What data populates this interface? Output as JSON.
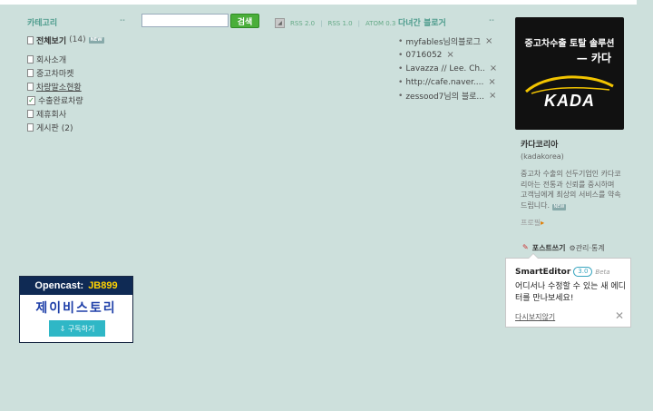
{
  "category": {
    "title": "카테고리",
    "all_label": "전체보기",
    "all_count": "(14)",
    "new_badge": "NEW",
    "items": [
      {
        "label": "회사소개",
        "check": false,
        "underline": false
      },
      {
        "label": "중고차마켓",
        "check": false,
        "underline": false
      },
      {
        "label": "차량말소현황",
        "check": false,
        "underline": true
      },
      {
        "label": "수출완료차량",
        "check": true,
        "underline": false
      },
      {
        "label": "제휴회사",
        "check": false,
        "underline": false
      },
      {
        "label": "게시판 (2)",
        "check": false,
        "underline": false
      }
    ]
  },
  "search": {
    "placeholder": "",
    "button_label": "검색"
  },
  "rss": {
    "items": [
      "RSS 2.0",
      "RSS 1.0",
      "ATOM 0.3"
    ]
  },
  "neighbors": {
    "title": "다녀간 블로거",
    "items": [
      "myfables님의블로그",
      "0716052",
      "Lavazza // Lee. Ch..",
      "http://cafe.naver....",
      "zessood7님의 블로..."
    ]
  },
  "profile": {
    "logo_line1": "중고차수출 토탈 솔루션",
    "logo_line2": "— 카다",
    "logo_brand": "KADA",
    "name": "카다코리아",
    "id": "(kadakorea)",
    "description": "중고차 수출의 선두기업인 카다코리아는 전통과 신뢰를 중시하며 고객님에게 최상의 서비스를 약속드립니다.",
    "description_badge": "NEW",
    "profile_link": "프로필",
    "write_label": "포스트쓰기",
    "manage_label": "관리·통계"
  },
  "smarteditor": {
    "name": "SmartEditor",
    "version": "3.0",
    "beta": "Beta",
    "message": "어디서나 수정할 수 있는 새 에디터를 만나보세요!",
    "dismiss": "다시보지않기"
  },
  "opencast": {
    "brand": "Opencast:",
    "code": "JB899",
    "title": "제이비스토리",
    "subscribe": "구독하기"
  },
  "colors": {
    "background": "#cde0dc",
    "accent": "#4f9d8e",
    "search_button": "#4aae3a",
    "opencast_header": "#0f2a54"
  }
}
